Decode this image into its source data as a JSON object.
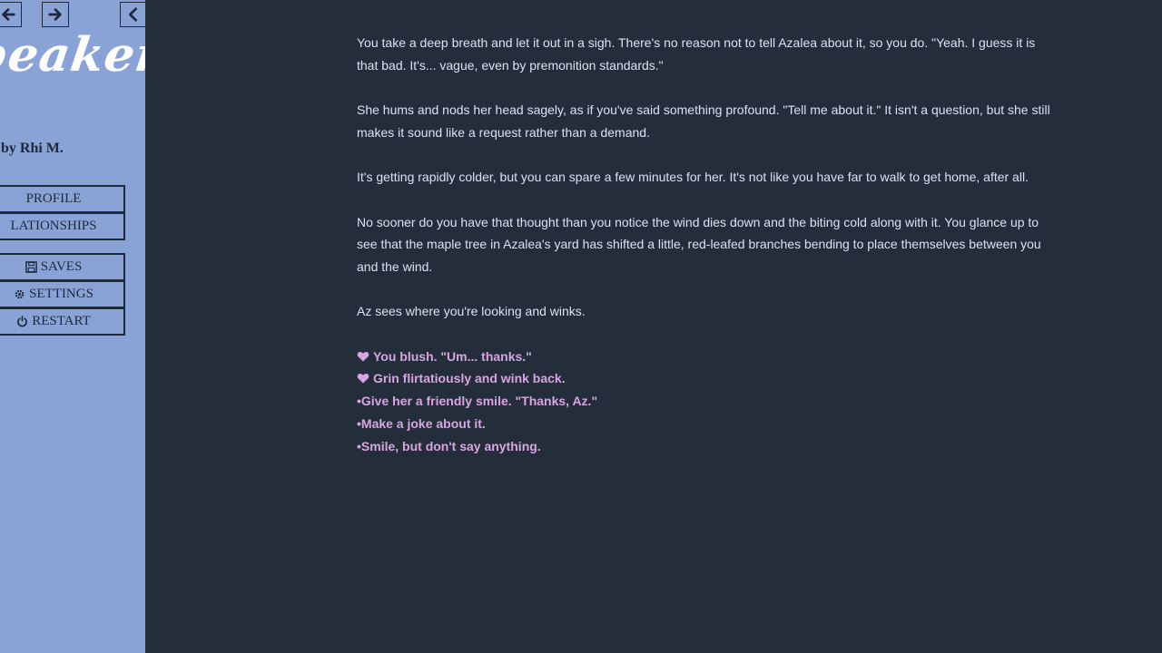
{
  "sidebar": {
    "nav": {
      "back_icon": "arrow-left-icon",
      "forward_icon": "arrow-right-icon",
      "collapse_icon": "chevron-left-icon"
    },
    "title": "beaker",
    "author": "by Rhi M.",
    "menu": {
      "profile": "PROFILE",
      "relationships": "LATIONSHIPS",
      "saves": "SAVES",
      "settings": "SETTINGS",
      "restart": "RESTART"
    }
  },
  "story": {
    "paragraphs": [
      "You take a deep breath and let it out in a sigh. There's no reason not to tell Azalea about it, so you do. \"Yeah. I guess it is that bad. It's... vague, even by premonition standards.\"",
      "She hums and nods her head sagely, as if you've said something profound. \"Tell me about it.\" It isn't a question, but she still makes it sound like a request rather than a demand.",
      "It's getting rapidly colder, but you can spare a few minutes for her. It's not like you have far to walk to get home, after all.",
      "No sooner do you have that thought than you notice the wind dies down and the biting cold along with it. You glance up to see that the maple tree in Azalea's yard has shifted a little, red-leafed branches bending to place themselves between you and the wind.",
      "Az sees where you're looking and winks."
    ],
    "choices": [
      "You blush. \"Um... thanks.\"",
      "Grin flirtatiously and wink back.",
      "•Give her a friendly smile. \"Thanks, Az.\"",
      "•Make a joke about it.",
      "•Smile, but don't say anything."
    ]
  },
  "colors": {
    "sidebar_bg": "#8aa3d6",
    "main_bg": "#242d3a",
    "text": "#d6e3f7",
    "choice": "#d7a5e0",
    "border": "#1e2a3c"
  }
}
